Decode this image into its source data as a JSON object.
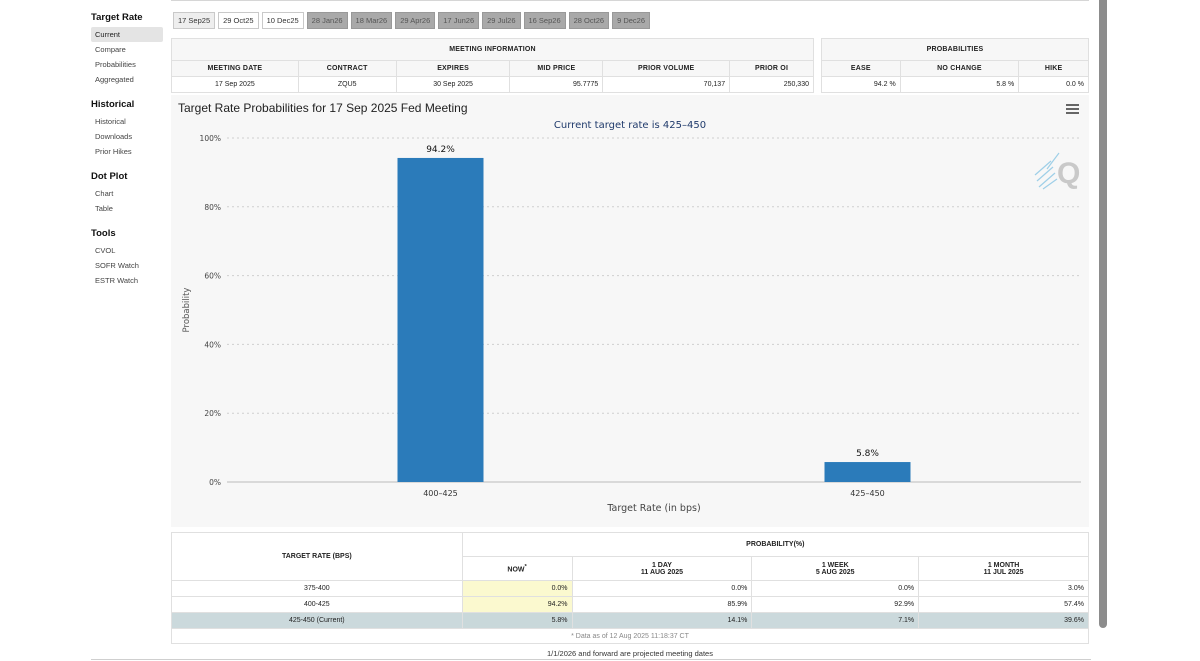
{
  "sidebar": {
    "sections": [
      {
        "title": "Target Rate",
        "items": [
          "Current",
          "Compare",
          "Probabilities",
          "Aggregated"
        ]
      },
      {
        "title": "Historical",
        "items": [
          "Historical",
          "Downloads",
          "Prior Hikes"
        ]
      },
      {
        "title": "Dot Plot",
        "items": [
          "Chart",
          "Table"
        ]
      },
      {
        "title": "Tools",
        "items": [
          "CVOL",
          "SOFR Watch",
          "ESTR Watch"
        ]
      }
    ],
    "active_item": "Current"
  },
  "tabs": [
    {
      "label": "17 Sep25",
      "state": "active"
    },
    {
      "label": "29 Oct25",
      "state": "normal"
    },
    {
      "label": "10 Dec25",
      "state": "normal"
    },
    {
      "label": "28 Jan26",
      "state": "projected"
    },
    {
      "label": "18 Mar26",
      "state": "projected"
    },
    {
      "label": "29 Apr26",
      "state": "projected"
    },
    {
      "label": "17 Jun26",
      "state": "projected"
    },
    {
      "label": "29 Jul26",
      "state": "projected"
    },
    {
      "label": "16 Sep26",
      "state": "projected"
    },
    {
      "label": "28 Oct26",
      "state": "projected"
    },
    {
      "label": "9 Dec26",
      "state": "projected"
    }
  ],
  "meeting_info": {
    "heading": "MEETING INFORMATION",
    "columns": [
      "MEETING DATE",
      "CONTRACT",
      "EXPIRES",
      "MID PRICE",
      "PRIOR VOLUME",
      "PRIOR OI"
    ],
    "values": [
      "17 Sep 2025",
      "ZQU5",
      "30 Sep 2025",
      "95.7775",
      "70,137",
      "250,330"
    ]
  },
  "probabilities": {
    "heading": "PROBABILITIES",
    "columns": [
      "EASE",
      "NO CHANGE",
      "HIKE"
    ],
    "values": [
      "94.2 %",
      "5.8 %",
      "0.0 %"
    ]
  },
  "chart": {
    "heading": "Target Rate Probabilities for 17 Sep 2025 Fed Meeting",
    "bar_color": "#2b7bba"
  },
  "chart_data": {
    "type": "bar",
    "title": "Target Rate Probabilities for 17 Sep 2025 Fed Meeting",
    "subtitle": "Current target rate is 425–450",
    "categories": [
      "400–425",
      "425–450"
    ],
    "values": [
      94.2,
      5.8
    ],
    "data_labels": [
      "94.2%",
      "5.8%"
    ],
    "xlabel": "Target Rate (in bps)",
    "ylabel": "Probability",
    "ylim": [
      0,
      100
    ],
    "yticks": [
      0,
      20,
      40,
      60,
      80,
      100
    ],
    "ytick_labels": [
      "0%",
      "20%",
      "40%",
      "60%",
      "80%",
      "100%"
    ],
    "grid": true
  },
  "prob_table": {
    "col_target": "TARGET RATE (BPS)",
    "col_group": "PROBABILITY(%)",
    "now_label": "NOW",
    "now_mark": "*",
    "periods": [
      {
        "label": "1 DAY",
        "date": "11 AUG 2025"
      },
      {
        "label": "1 WEEK",
        "date": "5 AUG 2025"
      },
      {
        "label": "1 MONTH",
        "date": "11 JUL 2025"
      }
    ],
    "rows": [
      {
        "rate": "375-400",
        "values": [
          "0.0%",
          "0.0%",
          "0.0%",
          "3.0%"
        ]
      },
      {
        "rate": "400-425",
        "values": [
          "94.2%",
          "85.9%",
          "92.9%",
          "57.4%"
        ]
      },
      {
        "rate": "425-450 (Current)",
        "values": [
          "5.8%",
          "14.1%",
          "7.1%",
          "39.6%"
        ]
      }
    ],
    "note": "* Data as of 12 Aug 2025 11:18:37 CT"
  },
  "footnote": "1/1/2026 and forward are projected meeting dates",
  "watermark": "Q"
}
